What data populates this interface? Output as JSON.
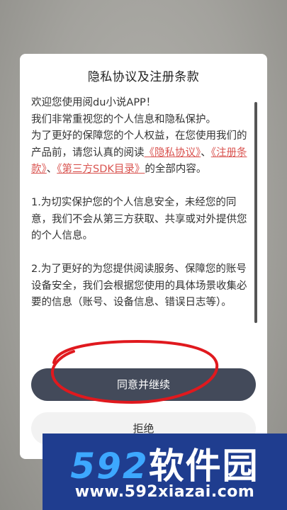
{
  "dialog": {
    "title": "隐私协议及注册条款",
    "welcome": "欢迎您使用阅du小说APP！",
    "line2": "我们非常重视您的个人信息和隐私保护。",
    "line3_prefix": "为了更好的保障您的个人权益，在您使用我们的产品前，请您认真的阅读",
    "link_privacy": "《隐私协议》",
    "sep1": "、",
    "link_terms": "《注册条款》",
    "sep2": "、",
    "link_sdk": "《第三方SDK目录》",
    "line3_suffix": "的全部内容。",
    "para1": "1.为切实保护您的个人信息安全，未经您的同意，我们不会从第三方获取、共享或对外提供您的个人信息。",
    "para2": "2.为了更好的为您提供阅读服务、保障您的账号设备安全，我们会根据您使用的具体场景收集必要的信息（账号、设备信息、错误日志等）。",
    "agree_label": "同意并继续",
    "reject_label": "拒绝"
  },
  "colors": {
    "link": "#d9534f",
    "agree_button": "#434a5a",
    "annotation": "#e0191e",
    "watermark_bg": "#1f3d8f"
  },
  "watermark": {
    "logo_digits": "592",
    "logo_text": "软件园",
    "url": "www.592xiazai.com"
  }
}
